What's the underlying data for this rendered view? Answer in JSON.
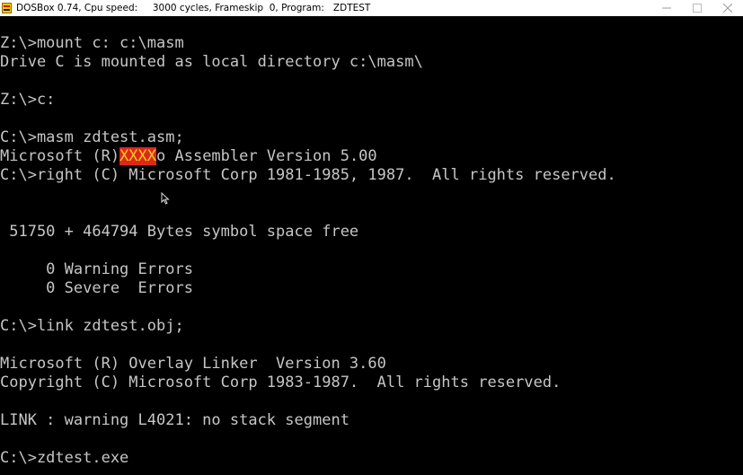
{
  "window": {
    "title": "DOSBox 0.74, Cpu speed:     3000 cycles, Frameskip  0, Program:   ZDTEST",
    "controls": [
      "minimize-icon",
      "maximize-icon",
      "close-icon"
    ]
  },
  "terminal": {
    "lines": [
      "Z:\\>mount c: c:\\masm",
      "Drive C is mounted as local directory c:\\masm\\",
      "",
      "Z:\\>c:",
      "",
      "C:\\>masm zdtest.asm;",
      "Microsoft (R)XXXXo Assembler Version 5.00",
      "C:\\>right (C) Microsoft Corp 1981-1985, 1987.  All rights reserved.",
      "",
      "",
      " 51750 + 464794 Bytes symbol space free",
      "",
      "     0 Warning Errors",
      "     0 Severe  Errors",
      "",
      "C:\\>link zdtest.obj;",
      "",
      "Microsoft (R) Overlay Linker  Version 3.60",
      "Copyright (C) Microsoft Corp 1983-1987.  All rights reserved.",
      "",
      "LINK : warning L4021: no stack segment",
      "",
      "C:\\>zdtest.exe"
    ],
    "line6_pre": "Microsoft (R)",
    "line6_glitch": "XXXX",
    "line6_post": "o Assembler Version 5.00"
  },
  "colors": {
    "text": "#c6c6c6",
    "background": "#000000",
    "glitch_bg": "#e0261b",
    "glitch_fg": "#e8d21a"
  }
}
